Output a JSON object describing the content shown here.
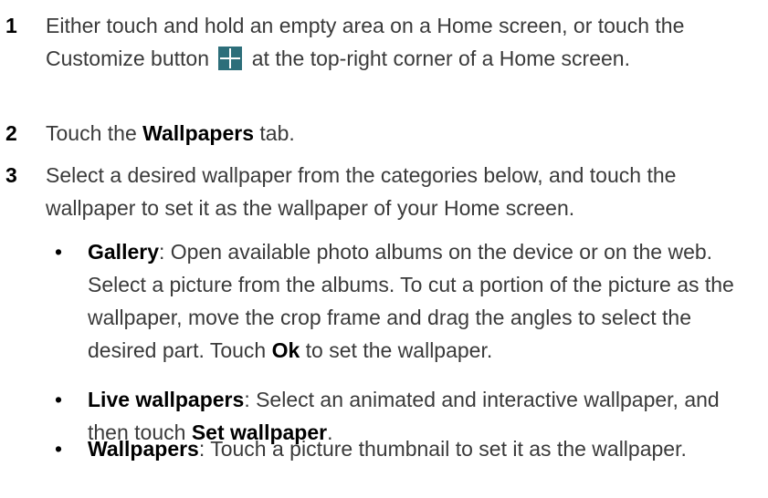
{
  "steps": [
    {
      "number": "1",
      "text_a": "Either touch and hold an empty area on a Home screen, or touch the Customize button",
      "icon": "plus-icon",
      "text_b": "at the top-right corner of a Home screen."
    },
    {
      "number": "2",
      "pre": "Touch the ",
      "bold": "Wallpapers",
      "post": " tab."
    },
    {
      "number": "3",
      "text": "Select a desired wallpaper from the categories below, and touch the wallpaper to set it as the wallpaper of your Home screen."
    }
  ],
  "bullets": [
    {
      "symbol": "•",
      "term": "Gallery",
      "text_a": ": Open available photo albums on the device or on the web. Select a picture from the albums. To cut a portion of the picture as the wallpaper, move the crop frame and drag the angles to select the desired part. Touch ",
      "bold": "Ok",
      "text_b": " to set the wallpaper."
    },
    {
      "symbol": "•",
      "term": "Live wallpapers",
      "text_a": ": Select an animated and interactive wallpaper, and then touch ",
      "bold": "Set wallpaper",
      "text_b": "."
    },
    {
      "symbol": "•",
      "term": "Wallpapers",
      "text_a": ": Touch a picture thumbnail to set it as the wallpaper."
    }
  ]
}
